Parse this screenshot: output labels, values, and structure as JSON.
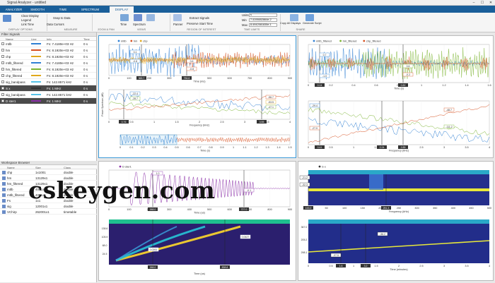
{
  "window": {
    "title": "Signal Analyzer - untitled",
    "controls": [
      "–",
      "☐",
      "✕"
    ]
  },
  "tabs": [
    "ANALYZER",
    "SMOOTH",
    "TIME",
    "SPECTRUM",
    "DISPLAY"
  ],
  "ribbon": {
    "clear_display": "Clear Display",
    "legend": "Legend",
    "link_time": "Link Time",
    "snap_to_data": "Snap to Data",
    "data_cursors": "Data Cursors",
    "zoom": "Time",
    "spectrum": "Spectrum",
    "panner": "Panner",
    "extract_signals": "Extract Signals",
    "preserve_start_time": "Preserve Start Time",
    "units_label": "Units",
    "units_value": "s",
    "min_label": "Min",
    "min_value": "7.4195652864e-2",
    "max_label": "Max",
    "max_value": "8.4942581835e-1",
    "copy_all_displays": "Copy All Displays",
    "generate_script": "Generate Script",
    "sections": [
      "DISPLAY OPTIONS",
      "MEASURE",
      "ZOOM & PAN",
      "VIEWS",
      "REGION OF INTEREST",
      "TIME LIMITS",
      "SHARE"
    ]
  },
  "filter": {
    "label": "Filter Signals"
  },
  "signal_table": {
    "headers": [
      "Name",
      "Line",
      "Info",
      "Time"
    ],
    "rows": [
      {
        "name": "mtlb",
        "info": "Fs: 7.4180e+03 Hz",
        "time": "0 s",
        "color": "#2f7fd3"
      },
      {
        "name": "hm",
        "info": "Fs: 8.1920e+03 Hz",
        "time": "0 s",
        "color": "#d64f1f"
      },
      {
        "name": "chp",
        "info": "Fs: 8.1920e+03 Hz",
        "time": "0 s",
        "color": "#e0a81b"
      },
      {
        "name": "mtlb_filtered",
        "info": "Fs: 7.4180e+03 Hz",
        "time": "0 s",
        "color": "#2f7fd3"
      },
      {
        "name": "hm_filtered",
        "info": "Fs: 8.1920e+03 Hz",
        "time": "0 s",
        "color": "#7ab32f"
      },
      {
        "name": "chp_filtered",
        "info": "Fs: 8.1920e+03 Hz",
        "time": "0 s",
        "color": "#e0a81b"
      },
      {
        "name": "sig_bandpass",
        "info": "Fs: 142.8571 kHz",
        "time": "0 s",
        "color": "#57c3e8"
      },
      {
        "name": "S x",
        "info": "Fs: 1 MHz",
        "time": "0 s",
        "color": "#333333",
        "selected": true
      },
      {
        "name": "sig_bandpass",
        "info": "Fs: 142.8571 kHz",
        "time": "0 s",
        "color": "#57c3e8"
      },
      {
        "name": "D ster1",
        "info": "Fs: 1 MHz",
        "time": "0 s",
        "color": "#8b2fa8",
        "selected": true
      }
    ]
  },
  "workspace": {
    "title": "Workspace Browser",
    "headers": [
      "Name",
      "Size",
      "Class"
    ],
    "rows": [
      {
        "name": "chp",
        "size": "1x1001",
        "class": "double"
      },
      {
        "name": "hm",
        "size": "13129x1",
        "class": "double"
      },
      {
        "name": "hm_filtered",
        "size": "13129x1",
        "class": "double"
      },
      {
        "name": "mtlb",
        "size": "4001x1",
        "class": "double"
      },
      {
        "name": "mtlb_filtered",
        "size": "4001x1",
        "class": "double"
      },
      {
        "name": "Fs",
        "size": "1x1",
        "class": "double"
      },
      {
        "name": "sig",
        "size": "12001x1",
        "class": "double"
      },
      {
        "name": "VChirp",
        "size": "262001x1",
        "class": "timetable"
      }
    ]
  },
  "watermark": "cskeygen.com",
  "display1": {
    "legend": [
      "mtlb",
      "hm",
      "chp"
    ],
    "time_xlabel": "Time (ms)",
    "spec_xlabel": "Frequency (kHz)",
    "spec_ylabel": "Power Spectrum (dB)",
    "pan_xlabel": "Time (s)",
    "time_xticks": [
      "0",
      "100",
      "200",
      "300",
      "400",
      "500",
      "600",
      "700",
      "800",
      "900"
    ],
    "spec_xticks": [
      "0",
      "0.5",
      "1",
      "1.5",
      "2",
      "2.5",
      "3",
      "3.5",
      "4"
    ],
    "pan_xticks": [
      "0",
      "0.1",
      "0.2",
      "0.3",
      "0.4",
      "0.5",
      "0.6",
      "0.7",
      "0.8",
      "0.9",
      "1",
      "1.1",
      "1.2",
      "1.3",
      "1.4",
      "1.5"
    ],
    "cursor_labels": {
      "t1": "365.7",
      "t2": "756.8",
      "f1": "0.76",
      "f2": "3.55"
    },
    "annotations": [
      "0.1",
      "-0.8",
      "0.6",
      "-0.8",
      "-22.4",
      "-28.7",
      "-56.7",
      "-53.5",
      "-47.1"
    ]
  },
  "display2": {
    "legend": [
      "mtlb_filtered",
      "hm_filtered",
      "chp_filtered"
    ],
    "time_xlabel": "Time (s)",
    "spec_xlabel": "Frequency (kHz)",
    "time_xticks": [
      "0",
      "0.2",
      "0.4",
      "0.6",
      "0.8",
      "1",
      "1.2",
      "1.4",
      "1.6"
    ],
    "spec_xticks": [
      "0",
      "0.5",
      "1",
      "1.5",
      "2",
      "2.5",
      "3",
      "3.5",
      "4"
    ],
    "cursor_labels": {
      "t1": "0.14",
      "t2": "0.82",
      "f1": "0.41",
      "f2": "2.24",
      "f3": "2.85"
    },
    "annotations": [
      "0.7",
      "-1.0",
      "0.6",
      "-0.2",
      "-29.4",
      "-27.9",
      "-48.7",
      "-111.2"
    ]
  },
  "display3": {
    "legend": [
      "D ster1"
    ],
    "time_xlabel": "Time (us)",
    "spec_xlabel": "Time (us)",
    "time_xticks": [
      "0",
      "100",
      "200",
      "300",
      "400",
      "500",
      "600",
      "700",
      "800",
      "900"
    ],
    "cursor_labels": {
      "t1": "268.0",
      "t2": "727.0",
      "s1": "268.0",
      "s2": "838.8"
    },
    "annotations": [
      "1.0",
      "-0.1",
      "0.0261",
      "0.0627"
    ],
    "yticks": [
      "138.6",
      "105.9",
      "68.0",
      "24.5"
    ]
  },
  "display4": {
    "legend": [
      "S x"
    ],
    "spec_xlabel": "Frequency (kHz)",
    "spec2_xlabel": "Time (minutes)",
    "spec_xticks": [
      "0",
      "50",
      "100",
      "150",
      "200",
      "250",
      "300",
      "350",
      "400",
      "450",
      "500"
    ],
    "spec2_xticks": [
      "0",
      "0.5",
      "1",
      "1.5",
      "2",
      "2.5",
      "3",
      "3.5",
      "4"
    ],
    "cursor_labels": {
      "f1": "133.0",
      "f2": "251.3",
      "t1": "1.6",
      "t2": "3.2"
    },
    "annotations": [
      "-21.2",
      "-32.3",
      "-36.2",
      "-37.5"
    ],
    "yticks": [
      "367.0",
      "205.2",
      "298.1"
    ]
  },
  "colors": {
    "blue": "#2f7fd3",
    "orange": "#d64f1f",
    "yellow": "#e0a81b",
    "green": "#7ab32f",
    "purple": "#8b2fa8",
    "accent": "#1a5f9a"
  }
}
